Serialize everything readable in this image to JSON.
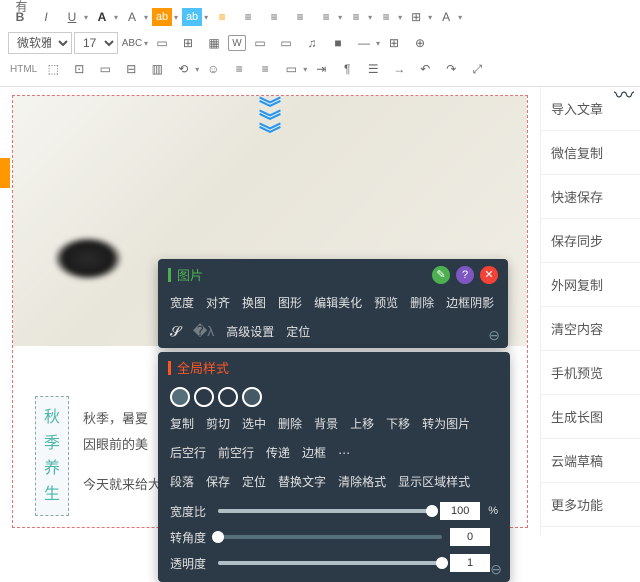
{
  "toolbar": {
    "font_family": "微软雅黑",
    "font_size": "17px",
    "abc_label": "ABC",
    "html_label": "HTML"
  },
  "editor": {
    "side_vertical_label": "有",
    "badge_chars": [
      "秋",
      "季",
      "养",
      "生"
    ],
    "line1": "秋季，暑夏",
    "line2": "因眼前的美",
    "line3": "今天就来给大家介绍一些秋季养生的食谱与饮食忌讳"
  },
  "panel_image": {
    "title": "图片",
    "items_row1": [
      "宽度",
      "对齐",
      "换图",
      "图形",
      "编辑美化",
      "预览",
      "删除",
      "边框阴影"
    ],
    "items_row2": [
      "高级设置",
      "定位"
    ]
  },
  "panel_global": {
    "title": "全局样式",
    "items_row1": [
      "复制",
      "剪切",
      "选中",
      "删除",
      "背景",
      "上移",
      "下移",
      "转为图片"
    ],
    "items_row2": [
      "后空行",
      "前空行",
      "传递",
      "边框"
    ],
    "items_row3": [
      "段落",
      "保存",
      "定位",
      "替换文字",
      "清除格式",
      "显示区域样式"
    ],
    "sliders": [
      {
        "label": "宽度比",
        "value": "100",
        "unit": "%",
        "fill": 100
      },
      {
        "label": "转角度",
        "value": "0",
        "unit": "",
        "fill": 0
      },
      {
        "label": "透明度",
        "value": "1",
        "unit": "",
        "fill": 100
      }
    ]
  },
  "right_menu": {
    "items": [
      "导入文章",
      "微信复制",
      "快速保存",
      "保存同步",
      "外网复制",
      "清空内容",
      "手机预览",
      "生成长图",
      "云端草稿",
      "更多功能"
    ]
  }
}
